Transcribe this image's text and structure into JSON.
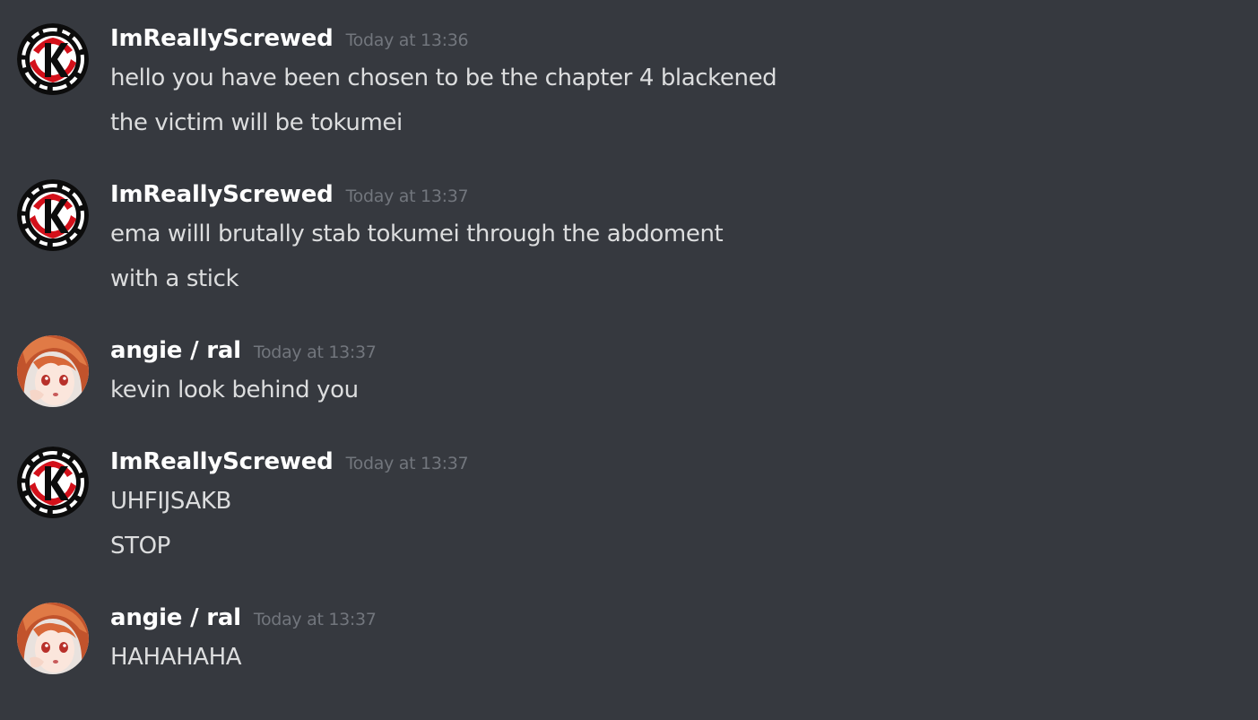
{
  "messages": [
    {
      "author": "ImReallyScrewed",
      "avatar": "kaito-emblem-avatar",
      "timestamp": "Today at 13:36",
      "lines": [
        "hello you have been chosen to be the chapter 4 blackened",
        "the victim will be tokumei"
      ]
    },
    {
      "author": "ImReallyScrewed",
      "avatar": "kaito-emblem-avatar",
      "timestamp": "Today at 13:37",
      "lines": [
        "ema willl brutally stab tokumei through the abdoment",
        "with a stick"
      ]
    },
    {
      "author": "angie / ral",
      "avatar": "anime-girl-avatar",
      "timestamp": "Today at 13:37",
      "lines": [
        "kevin look behind you"
      ]
    },
    {
      "author": "ImReallyScrewed",
      "avatar": "kaito-emblem-avatar",
      "timestamp": "Today at 13:37",
      "lines": [
        "UHFIJSAKB",
        "STOP"
      ]
    },
    {
      "author": "angie / ral",
      "avatar": "anime-girl-avatar",
      "timestamp": "Today at 13:37",
      "lines": [
        "HAHAHAHA"
      ]
    }
  ],
  "colors": {
    "background": "#36393f",
    "username": "#ffffff",
    "timestamp": "#72767d",
    "message_text": "#dcddde"
  }
}
